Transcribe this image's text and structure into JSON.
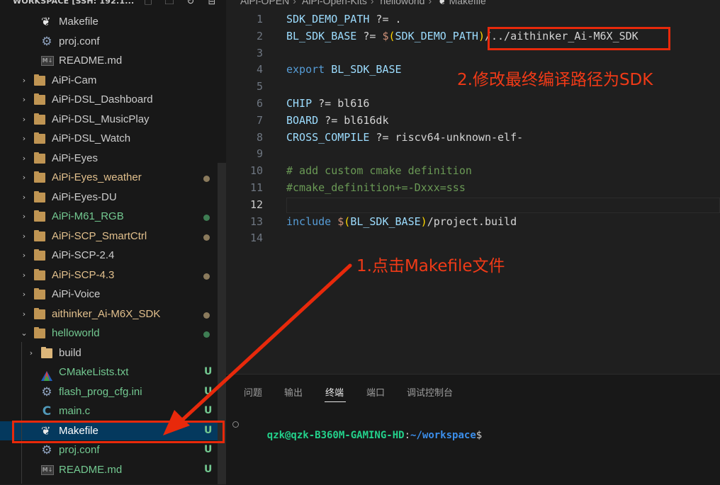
{
  "sidebar": {
    "title": "WORKSPACE [SSH: 192.1...",
    "header_icons": [
      "new-file-icon",
      "new-folder-icon",
      "refresh-icon",
      "collapse-all-icon"
    ],
    "items": [
      {
        "label": "Makefile",
        "indent": 2,
        "icon": "makefile-icon",
        "chevron": ""
      },
      {
        "label": "proj.conf",
        "indent": 2,
        "icon": "gear-icon",
        "chevron": ""
      },
      {
        "label": "README.md",
        "indent": 2,
        "icon": "markdown-icon",
        "chevron": ""
      },
      {
        "label": "AiPi-Cam",
        "indent": 1,
        "icon": "folder-icon",
        "chevron": "›"
      },
      {
        "label": "AiPi-DSL_Dashboard",
        "indent": 1,
        "icon": "folder-icon",
        "chevron": "›"
      },
      {
        "label": "AiPi-DSL_MusicPlay",
        "indent": 1,
        "icon": "folder-icon",
        "chevron": "›"
      },
      {
        "label": "AiPi-DSL_Watch",
        "indent": 1,
        "icon": "folder-icon",
        "chevron": "›"
      },
      {
        "label": "AiPi-Eyes",
        "indent": 1,
        "icon": "folder-icon",
        "chevron": "›"
      },
      {
        "label": "AiPi-Eyes_weather",
        "indent": 1,
        "icon": "folder-icon",
        "chevron": "›",
        "git": "mod"
      },
      {
        "label": "AiPi-Eyes-DU",
        "indent": 1,
        "icon": "folder-icon",
        "chevron": "›"
      },
      {
        "label": "AiPi-M61_RGB",
        "indent": 1,
        "icon": "folder-icon",
        "chevron": "›",
        "git": "new"
      },
      {
        "label": "AiPi-SCP_SmartCtrl",
        "indent": 1,
        "icon": "folder-icon",
        "chevron": "›",
        "git": "mod"
      },
      {
        "label": "AiPi-SCP-2.4",
        "indent": 1,
        "icon": "folder-icon",
        "chevron": "›"
      },
      {
        "label": "AiPi-SCP-4.3",
        "indent": 1,
        "icon": "folder-icon",
        "chevron": "›",
        "git": "mod"
      },
      {
        "label": "AiPi-Voice",
        "indent": 1,
        "icon": "folder-icon",
        "chevron": "›"
      },
      {
        "label": "aithinker_Ai-M6X_SDK",
        "indent": 1,
        "icon": "folder-icon",
        "chevron": "›",
        "git": "mod"
      },
      {
        "label": "helloworld",
        "indent": 1,
        "icon": "folder-icon",
        "chevron": "⌄",
        "git": "new"
      },
      {
        "label": "build",
        "indent": 2,
        "icon": "build-folder-icon",
        "chevron": "›"
      },
      {
        "label": "CMakeLists.txt",
        "indent": 2,
        "icon": "cmake-icon",
        "chevron": "",
        "git": "U"
      },
      {
        "label": "flash_prog_cfg.ini",
        "indent": 2,
        "icon": "gear-icon",
        "chevron": "",
        "git": "U"
      },
      {
        "label": "main.c",
        "indent": 2,
        "icon": "c-file-icon",
        "chevron": "",
        "git": "U"
      },
      {
        "label": "Makefile",
        "indent": 2,
        "icon": "makefile-icon",
        "chevron": "",
        "git": "U",
        "selected": true
      },
      {
        "label": "proj.conf",
        "indent": 2,
        "icon": "gear-icon",
        "chevron": "",
        "git": "U"
      },
      {
        "label": "README.md",
        "indent": 2,
        "icon": "markdown-icon",
        "chevron": "",
        "git": "U"
      }
    ]
  },
  "breadcrumb": [
    "AiPi-OPEN",
    "AiPi-Open-Kits",
    "helloworld",
    "Makefile"
  ],
  "editor": {
    "active_line": 12,
    "lines": [
      {
        "n": "1",
        "tokens": [
          [
            "SDK_DEMO_PATH",
            "t-var"
          ],
          [
            " ?= ",
            "t-op"
          ],
          [
            ".",
            "t-plain"
          ]
        ]
      },
      {
        "n": "2",
        "tokens": [
          [
            "BL_SDK_BASE",
            "t-var"
          ],
          [
            " ?= ",
            "t-op"
          ],
          [
            "$",
            "t-mac"
          ],
          [
            "(",
            "t-paren"
          ],
          [
            "SDK_DEMO_PATH",
            "t-var"
          ],
          [
            ")",
            "t-paren"
          ],
          [
            "/../aithinker_Ai-M6X_SDK",
            "t-plain"
          ]
        ]
      },
      {
        "n": "3",
        "tokens": []
      },
      {
        "n": "4",
        "tokens": [
          [
            "export",
            "t-kw"
          ],
          [
            " BL_SDK_BASE",
            "t-var"
          ]
        ]
      },
      {
        "n": "5",
        "tokens": []
      },
      {
        "n": "6",
        "tokens": [
          [
            "CHIP",
            "t-var"
          ],
          [
            " ?= ",
            "t-op"
          ],
          [
            "bl616",
            "t-plain"
          ]
        ]
      },
      {
        "n": "7",
        "tokens": [
          [
            "BOARD",
            "t-var"
          ],
          [
            " ?= ",
            "t-op"
          ],
          [
            "bl616dk",
            "t-plain"
          ]
        ]
      },
      {
        "n": "8",
        "tokens": [
          [
            "CROSS_COMPILE",
            "t-var"
          ],
          [
            " ?= ",
            "t-op"
          ],
          [
            "riscv64-unknown-elf-",
            "t-plain"
          ]
        ]
      },
      {
        "n": "9",
        "tokens": []
      },
      {
        "n": "10",
        "tokens": [
          [
            "# add custom cmake definition",
            "t-com"
          ]
        ]
      },
      {
        "n": "11",
        "tokens": [
          [
            "#cmake_definition+=-Dxxx=sss",
            "t-com"
          ]
        ]
      },
      {
        "n": "12",
        "tokens": []
      },
      {
        "n": "13",
        "tokens": [
          [
            "include",
            "t-kw"
          ],
          [
            " ",
            "t-plain"
          ],
          [
            "$",
            "t-mac"
          ],
          [
            "(",
            "t-paren"
          ],
          [
            "BL_SDK_BASE",
            "t-var"
          ],
          [
            ")",
            "t-paren"
          ],
          [
            "/project.build",
            "t-plain"
          ]
        ]
      },
      {
        "n": "14",
        "tokens": []
      }
    ]
  },
  "panel": {
    "tabs": [
      "问题",
      "输出",
      "终端",
      "端口",
      "调试控制台"
    ],
    "active_tab": "终端",
    "terminal": {
      "user_host": "qzk@qzk-B360M-GAMING-HD",
      "colon": ":",
      "path": "~/workspace",
      "prompt": "$"
    }
  },
  "annotations": {
    "step1": "1.点击Makefile文件",
    "step2": "2.修改最终编译路径为SDK"
  },
  "colors": {
    "annotation_red": "#e8290b",
    "selection": "#04395e",
    "git_untracked": "#73c991",
    "git_modified": "#e2c08d"
  }
}
